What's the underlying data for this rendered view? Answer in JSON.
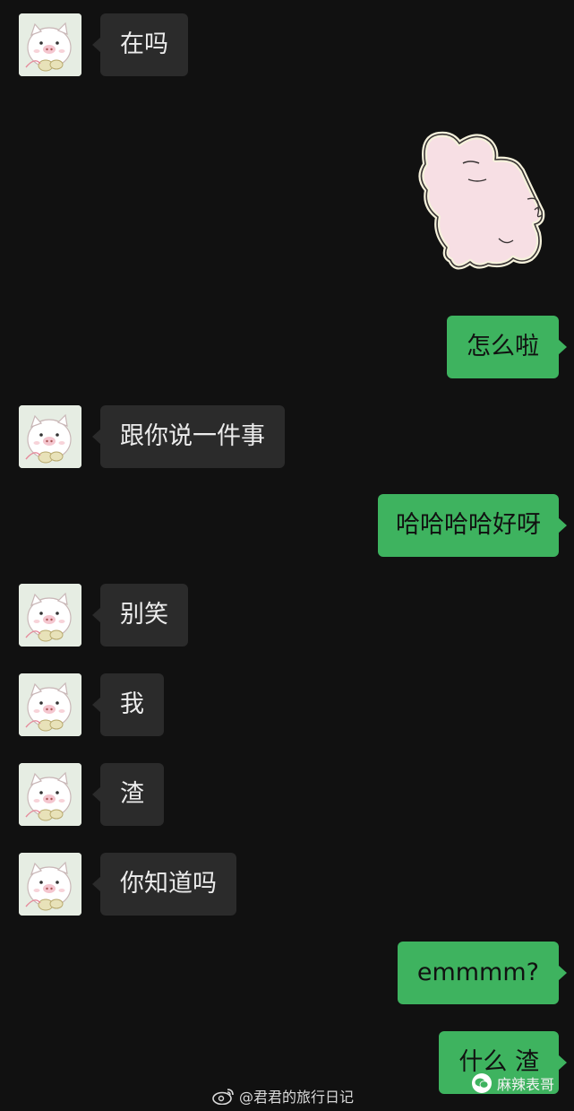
{
  "colors": {
    "background": "#111111",
    "incoming_bubble": "#2b2b2b",
    "outgoing_bubble": "#3eb35f"
  },
  "chat": {
    "messages": [
      {
        "side": "incoming",
        "text": "在吗"
      },
      {
        "side": "outgoing",
        "type": "sticker",
        "sticker": "pink-pig-sticker"
      },
      {
        "side": "outgoing",
        "text": "怎么啦"
      },
      {
        "side": "incoming",
        "text": "跟你说一件事"
      },
      {
        "side": "outgoing",
        "text": "哈哈哈哈好呀"
      },
      {
        "side": "incoming",
        "text": "别笑"
      },
      {
        "side": "incoming",
        "text": "我"
      },
      {
        "side": "incoming",
        "text": "渣"
      },
      {
        "side": "incoming",
        "text": "你知道吗"
      },
      {
        "side": "outgoing",
        "text": "emmmm?"
      },
      {
        "side": "outgoing",
        "text": "什么 渣"
      }
    ]
  },
  "icons": {
    "avatar": "pig-avatar-icon",
    "watermark": "weibo-icon",
    "corner": "wechat-official-account-icon"
  },
  "watermark": {
    "text": "@君君的旅行日记"
  },
  "corner_mark": {
    "text": "麻辣表哥"
  }
}
